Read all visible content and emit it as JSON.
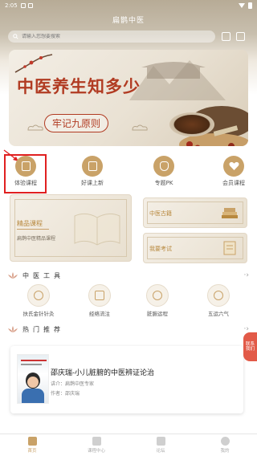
{
  "status_bar": {
    "time": "2:05"
  },
  "app": {
    "title": "扁鹊中医"
  },
  "search": {
    "placeholder": "请输入您想要搜索"
  },
  "banner": {
    "title": "中医养生知多少",
    "subtitle": "牢记九原则"
  },
  "quick_nav": [
    {
      "label": "体验课程",
      "icon": "course-icon"
    },
    {
      "label": "好课上新",
      "icon": "new-course-icon"
    },
    {
      "label": "专题PK",
      "icon": "pk-icon"
    },
    {
      "label": "会员课程",
      "icon": "heart-icon"
    }
  ],
  "featured": {
    "main_title": "精品课程",
    "main_subtitle": "扁鹊中医精品课程",
    "side": [
      {
        "label": "中医古籍"
      },
      {
        "label": "我要考试"
      }
    ]
  },
  "tools_section": {
    "title": "中医工具",
    "more": "·›"
  },
  "tools": [
    {
      "label": "扶氏金针针灸",
      "icon": "acupuncture-icon"
    },
    {
      "label": "经络流注",
      "icon": "meridian-icon"
    },
    {
      "label": "脏腑运程",
      "icon": "organ-icon"
    },
    {
      "label": "五运六气",
      "icon": "five-elements-icon"
    }
  ],
  "recommend_section": {
    "title": "热门推荐",
    "more": "·›"
  },
  "recommend": [
    {
      "title": "邵庆瑞-小儿脏腑的中医辨证论治",
      "subtitle": "讲介：扁鹊中医专家",
      "author": "作者：邵庆瑞"
    }
  ],
  "float_button": {
    "line1": "联系",
    "line2": "我们"
  },
  "bottom_nav": [
    {
      "label": "首页",
      "active": true
    },
    {
      "label": "课程中心",
      "active": false
    },
    {
      "label": "论坛",
      "active": false
    },
    {
      "label": "我的",
      "active": false
    }
  ],
  "colors": {
    "accent": "#c9a268",
    "banner_red": "#b13b22",
    "annotation": "#e02020"
  }
}
